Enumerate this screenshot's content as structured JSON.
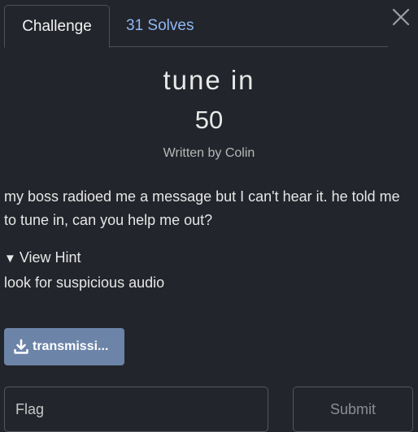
{
  "tabs": {
    "challenge_label": "Challenge",
    "solves_label": "31 Solves"
  },
  "challenge": {
    "title": "tune in",
    "points": "50",
    "author": "Written by Colin",
    "description": "my boss radioed me a message but I can't hear it. he told me to tune in, can you help me out?"
  },
  "hint": {
    "toggle_label": "View Hint",
    "text": "look for suspicious audio"
  },
  "file": {
    "label": "transmissi...",
    "icon": "download-icon"
  },
  "flag_form": {
    "placeholder": "Flag",
    "submit_label": "Submit"
  },
  "colors": {
    "background": "#22252b",
    "accent_link": "#8fb8f5",
    "file_button": "#6c84a8"
  }
}
